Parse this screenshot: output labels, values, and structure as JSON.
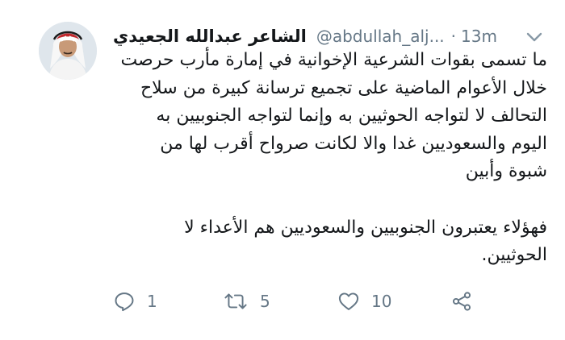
{
  "tweet": {
    "author_name": "الشاعر عبدالله الجعيدي",
    "handle": "@abdullah_alj...",
    "separator": "·",
    "time": "13m",
    "body_lines": [
      "ما تسمى بقوات الشرعية الإخوانية في إمارة مأرب حرصت",
      "خلال الأعوام الماضية على تجميع ترسانة كبيرة من سلاح",
      "التحالف لا لتواجه الحوثيين به وإنما لتواجه الجنوبيين به",
      "اليوم والسعوديين غدا والا لكانت صرواح أقرب لها من",
      "شبوة وأبين",
      "",
      "فهؤلاء يعتبرون الجنوبيين والسعوديين هم الأعداء لا",
      "الحوثيين."
    ]
  },
  "actions": {
    "reply_count": "1",
    "retweet_count": "5",
    "like_count": "10"
  },
  "icons": {
    "avatar": "profile-photo",
    "more": "chevron-down-icon",
    "reply": "reply-icon",
    "retweet": "retweet-icon",
    "like": "heart-icon",
    "share": "share-icon"
  },
  "colors": {
    "text": "#14171a",
    "secondary": "#657786",
    "background": "#ffffff"
  }
}
